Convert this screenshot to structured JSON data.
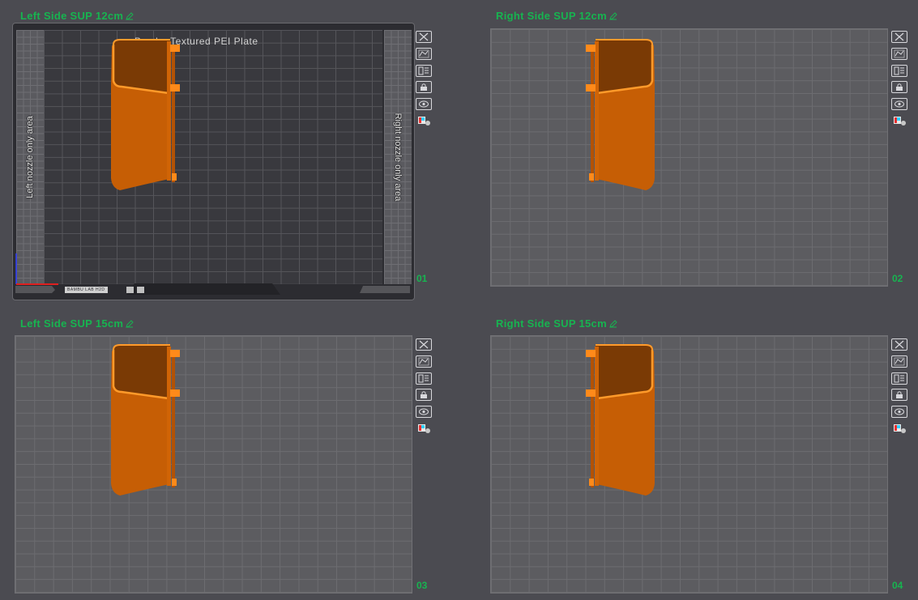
{
  "plates": [
    {
      "title": "Left Side SUP 12cm",
      "number": "01",
      "selected": true,
      "plate_label": "Bambu Textured PEI Plate",
      "left_strip_label": "Left nozzle only area",
      "right_strip_label": "Right nozzle only area",
      "footer_logo_text": "BAMBU LAB H2D"
    },
    {
      "title": "Right Side SUP 12cm",
      "number": "02",
      "selected": false
    },
    {
      "title": "Left Side SUP 15cm",
      "number": "03",
      "selected": false
    },
    {
      "title": "Right Side SUP 15cm",
      "number": "04",
      "selected": false
    }
  ],
  "toolbar": [
    "close-icon",
    "auto-orient-icon",
    "arrange-icon",
    "lock-icon",
    "preview-eye-icon",
    "filament-paint-icon"
  ],
  "colors": {
    "title_green": "#17b450",
    "model_orange": "#e26e06",
    "model_edge": "#ff8f1c",
    "model_dark": "#b35204",
    "background": "#4b4b51"
  }
}
